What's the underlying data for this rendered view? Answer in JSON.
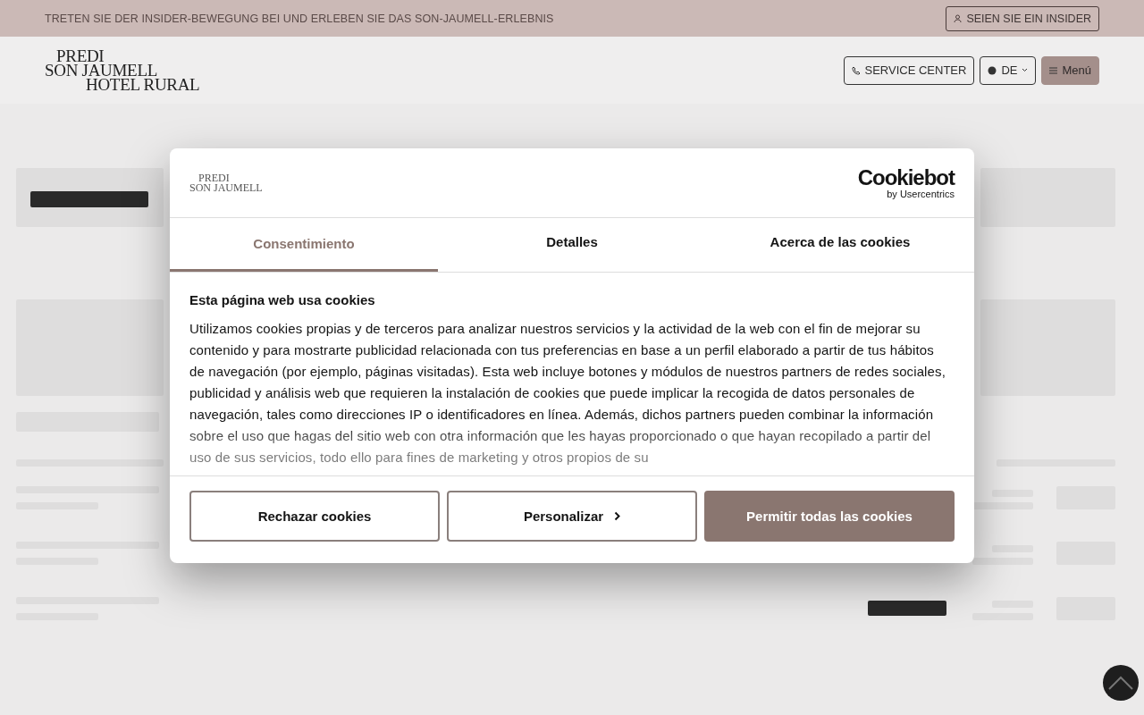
{
  "promo_bar": {
    "text": "TRETEN SIE DER INSIDER-BEWEGUNG BEI UND ERLEBEN SIE DAS SON-JAUMELL-ERLEBNIS",
    "button": "SEIEN SIE EIN INSIDER"
  },
  "header": {
    "logo_lines": [
      "PREDI",
      "SON JAUMELL",
      "HOTEL RURAL"
    ],
    "buttons": [
      {
        "kind": "service",
        "label": "SERVICE CENTER"
      },
      {
        "kind": "language",
        "label": "DE"
      },
      {
        "kind": "menu",
        "label": "Menú"
      }
    ]
  },
  "cookie_dialog": {
    "logo_lines": [
      "PREDI",
      "SON JAUMELL"
    ],
    "brand": "Cookiebot",
    "brand_sub": "by Usercentrics",
    "tabs": [
      {
        "label": "Consentimiento",
        "selected": true
      },
      {
        "label": "Detalles",
        "selected": false
      },
      {
        "label": "Acerca de las cookies",
        "selected": false
      }
    ],
    "heading": "Esta página web usa cookies",
    "body": "Utilizamos cookies propias y de terceros para analizar nuestros servicios y la actividad de la web con el fin de mejorar su contenido y para mostrarte publicidad relacionada con tus preferencias en base a un perfil elaborado a partir de tus hábitos de navegación (por ejemplo, páginas visitadas). Esta web incluye botones y módulos de nuestros partners de redes sociales, publicidad y análisis web que requieren la instalación de cookies que puede implicar la recogida de datos personales de navegación, tales como direcciones IP o identificadores en línea. Además, dichos partners pueden combinar la información sobre el uso que hagas del sitio web con otra información que les hayas proporcionado o que hayan recopilado a partir del uso de sus servicios, todo ello para fines de marketing y otros propios de su",
    "buttons": [
      {
        "kind": "outline",
        "label": "Rechazar cookies"
      },
      {
        "kind": "chevron",
        "label": "Personalizar"
      },
      {
        "kind": "primary",
        "label": "Permitir todas las cookies"
      }
    ]
  }
}
